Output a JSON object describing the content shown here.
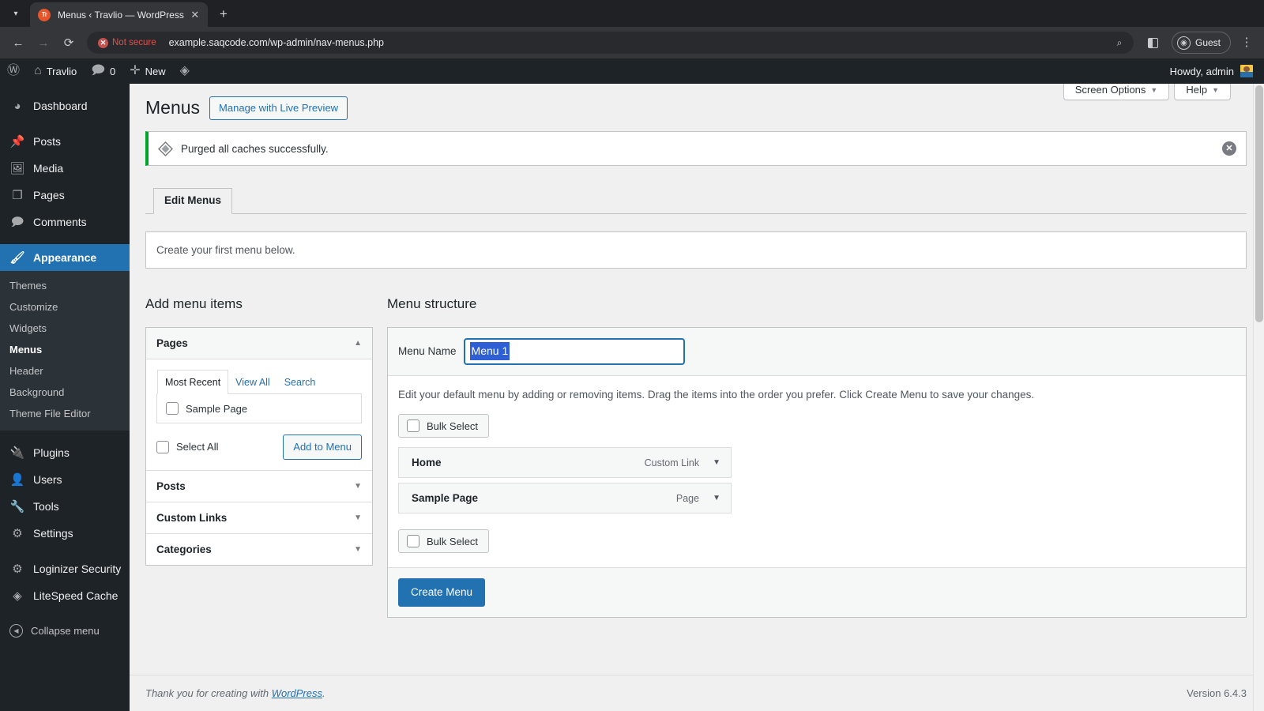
{
  "browser": {
    "tab": {
      "favicon_letters": "Tr",
      "title": "Menus ‹ Travlio — WordPress",
      "close_icon": "close-icon",
      "tab_search_icon": "chevron-down-icon",
      "new_tab_icon": "plus-icon"
    },
    "nav": {
      "back_icon": "arrow-left-icon",
      "forward_icon": "arrow-right-icon",
      "reload_icon": "reload-icon"
    },
    "omnibox": {
      "security_label": "Not secure",
      "security_icon": "not-secure-icon",
      "url": "example.saqcode.com/wp-admin/nav-menus.php",
      "zoom_icon": "zoom-search-icon"
    },
    "actions": {
      "split_view_icon": "split-panel-icon",
      "profile_label": "Guest",
      "profile_icon": "account-circle-icon",
      "menu_icon": "kebab-menu-icon"
    }
  },
  "adminbar": {
    "wp_logo_icon": "wordpress-logo-icon",
    "site_name": "Travlio",
    "site_icon": "home-icon",
    "comments_count": "0",
    "comments_icon": "comment-bubble-icon",
    "new_label": "New",
    "new_icon": "plus-icon",
    "litespeed_icon": "litespeed-diamond-icon",
    "howdy": "Howdy, admin",
    "avatar_icon": "avatar"
  },
  "sidebar": {
    "items": [
      {
        "label": "Dashboard",
        "icon": "dashboard-icon"
      },
      {
        "label": "Posts",
        "icon": "pin-icon"
      },
      {
        "label": "Media",
        "icon": "media-icon"
      },
      {
        "label": "Pages",
        "icon": "pages-icon"
      },
      {
        "label": "Comments",
        "icon": "comment-bubble-icon"
      },
      {
        "label": "Appearance",
        "icon": "paintbrush-icon"
      },
      {
        "label": "Plugins",
        "icon": "plug-icon"
      },
      {
        "label": "Users",
        "icon": "user-icon"
      },
      {
        "label": "Tools",
        "icon": "wrench-icon"
      },
      {
        "label": "Settings",
        "icon": "sliders-icon"
      },
      {
        "label": "Loginizer Security",
        "icon": "gear-icon"
      },
      {
        "label": "LiteSpeed Cache",
        "icon": "litespeed-diamond-icon"
      }
    ],
    "submenu": [
      {
        "label": "Themes"
      },
      {
        "label": "Customize"
      },
      {
        "label": "Widgets"
      },
      {
        "label": "Menus"
      },
      {
        "label": "Header"
      },
      {
        "label": "Background"
      },
      {
        "label": "Theme File Editor"
      }
    ],
    "collapse_label": "Collapse menu",
    "collapse_icon": "collapse-arrow-icon"
  },
  "screen_meta": {
    "screen_options_label": "Screen Options",
    "help_label": "Help",
    "caret_icon": "chevron-down-icon"
  },
  "page": {
    "title": "Menus",
    "live_preview_button": "Manage with Live Preview"
  },
  "notice": {
    "icon": "litespeed-diamond-icon",
    "text": "Purged all caches successfully.",
    "dismiss_icon": "close-circle-icon"
  },
  "tabs": [
    {
      "label": "Edit Menus",
      "active": true
    }
  ],
  "menu_message": "Create your first menu below.",
  "add_menu_items": {
    "heading": "Add menu items",
    "sections": [
      {
        "label": "Pages",
        "open": true,
        "caret_icon": "chevron-up-icon",
        "tabs": [
          {
            "label": "Most Recent",
            "active": true
          },
          {
            "label": "View All",
            "active": false
          },
          {
            "label": "Search",
            "active": false
          }
        ],
        "items": [
          {
            "label": "Sample Page",
            "checked": false
          }
        ],
        "select_all_label": "Select All",
        "add_button_label": "Add to Menu"
      },
      {
        "label": "Posts",
        "open": false,
        "caret_icon": "chevron-down-icon"
      },
      {
        "label": "Custom Links",
        "open": false,
        "caret_icon": "chevron-down-icon"
      },
      {
        "label": "Categories",
        "open": false,
        "caret_icon": "chevron-down-icon"
      }
    ]
  },
  "menu_structure": {
    "heading": "Menu structure",
    "menu_name_label": "Menu Name",
    "menu_name_value": "Menu 1",
    "instructions": "Edit your default menu by adding or removing items. Drag the items into the order you prefer. Click Create Menu to save your changes.",
    "bulk_select_top_label": "Bulk Select",
    "bulk_select_bottom_label": "Bulk Select",
    "items": [
      {
        "title": "Home",
        "type": "Custom Link",
        "toggle_icon": "chevron-down-icon"
      },
      {
        "title": "Sample Page",
        "type": "Page",
        "toggle_icon": "chevron-down-icon"
      }
    ],
    "create_button_label": "Create Menu"
  },
  "footer": {
    "thanks_prefix": "Thank you for creating with ",
    "wordpress_link": "WordPress",
    "thanks_suffix": ".",
    "version": "Version 6.4.3"
  },
  "colors": {
    "wp_blue": "#2271b1",
    "admin_dark": "#1d2327",
    "submenu_dark": "#2c3338",
    "notice_green": "#00a32a",
    "selection_blue": "#2f5fd4",
    "page_bg": "#f0f0f1"
  }
}
